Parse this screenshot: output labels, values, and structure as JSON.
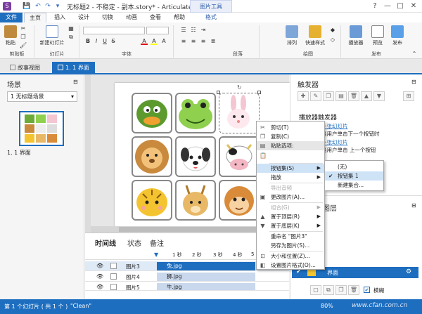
{
  "window": {
    "title": "无标题2 - 不稳定 - 副本.story* - Articulate Storyline 2",
    "context_tab_header": "图片工具",
    "minimize": "—",
    "restore": "□",
    "close": "✕"
  },
  "ribbon_tabs": [
    "文件",
    "主页",
    "插入",
    "设计",
    "切换",
    "动画",
    "查看",
    "帮助",
    "格式"
  ],
  "ribbon": {
    "paste": "粘贴",
    "new_slide": "新建幻灯片",
    "arrange": "排列",
    "quick_styles": "快速样式",
    "player": "播放器",
    "preview": "预览",
    "publish": "发布",
    "groups": {
      "clipboard": "剪贴板",
      "slides": "幻灯片",
      "font": "字体",
      "paragraph": "段落",
      "drawing": "绘图",
      "publish": "发布"
    },
    "font_buttons": [
      "B",
      "I",
      "U",
      "S"
    ]
  },
  "doc_tabs": [
    "故事视图",
    "1. 1 界面"
  ],
  "scenes_panel": {
    "title": "场景",
    "selected_scene": "1 无标题场景",
    "thumb_label": "1. 1 界面"
  },
  "timeline": {
    "tabs": [
      "时间线",
      "状态",
      "备注"
    ],
    "rulers": [
      "1 秒",
      "2 秒",
      "3 秒",
      "4 秒",
      "5"
    ],
    "rows": [
      {
        "name": "图片3",
        "clip": "兔.jpg"
      },
      {
        "name": "图片4",
        "clip": "狮.jpg"
      },
      {
        "name": "图片5",
        "clip": "牛.jpg"
      }
    ]
  },
  "triggers_panel": {
    "title": "触发器",
    "section_title": "播放器触发器",
    "items": [
      {
        "link": "一张幻灯片",
        "text": "当用户单击下一个按钮时"
      },
      {
        "link": "一张幻灯片",
        "text": "当用户单击 上一个按钮"
      }
    ],
    "layers_title": "图层",
    "layer_name": "界面",
    "dim_label": "模糊"
  },
  "context_menu": {
    "items": [
      {
        "label": "剪切(T)",
        "icon": "✂",
        "disabled": false,
        "submenu": false,
        "highlighted": false
      },
      {
        "label": "复制(C)",
        "icon": "❐",
        "disabled": false,
        "submenu": false,
        "highlighted": false
      },
      {
        "label": "粘贴选项:",
        "icon": "▤",
        "disabled": false,
        "submenu": false,
        "highlighted": true
      },
      {
        "label": "",
        "icon": "📋",
        "disabled": false,
        "submenu": false,
        "highlighted": false
      },
      {
        "label": "按钮集(S)",
        "icon": "",
        "disabled": false,
        "submenu": true,
        "highlighted": true
      },
      {
        "label": "拖放",
        "icon": "",
        "disabled": false,
        "submenu": true,
        "highlighted": false
      },
      {
        "label": "导出音频",
        "icon": "",
        "disabled": true,
        "submenu": false,
        "highlighted": false
      },
      {
        "label": "更改图片(A)...",
        "icon": "▣",
        "disabled": false,
        "submenu": false,
        "highlighted": false
      },
      {
        "label": "组合(G)",
        "icon": "",
        "disabled": true,
        "submenu": true,
        "highlighted": false
      },
      {
        "label": "置于顶层(R)",
        "icon": "▲",
        "disabled": false,
        "submenu": true,
        "highlighted": false
      },
      {
        "label": "置于底层(K)",
        "icon": "▼",
        "disabled": false,
        "submenu": true,
        "highlighted": false
      },
      {
        "label": "重命名 \"图片3\"",
        "icon": "",
        "disabled": false,
        "submenu": false,
        "highlighted": false
      },
      {
        "label": "另存为图片(S)...",
        "icon": "",
        "disabled": false,
        "submenu": false,
        "highlighted": false
      },
      {
        "label": "大小和位置(Z)...",
        "icon": "⊡",
        "disabled": false,
        "submenu": false,
        "highlighted": false
      },
      {
        "label": "设置图片格式(O)...",
        "icon": "◧",
        "disabled": false,
        "submenu": false,
        "highlighted": false
      }
    ],
    "submenu": [
      {
        "label": "(无)",
        "checked": false
      },
      {
        "label": "按钮集 1",
        "checked": true
      },
      {
        "label": "新建集合...",
        "checked": false
      }
    ]
  },
  "status": {
    "slide_info": "第 1 个幻灯片 ( 共 1 个 )",
    "theme": "\"Clean\"",
    "zoom": "80%",
    "watermark": "www.cfan.com.cn"
  },
  "colors": {
    "accent": "#1e6ec0",
    "menu_highlight": "#cfe3f7"
  }
}
